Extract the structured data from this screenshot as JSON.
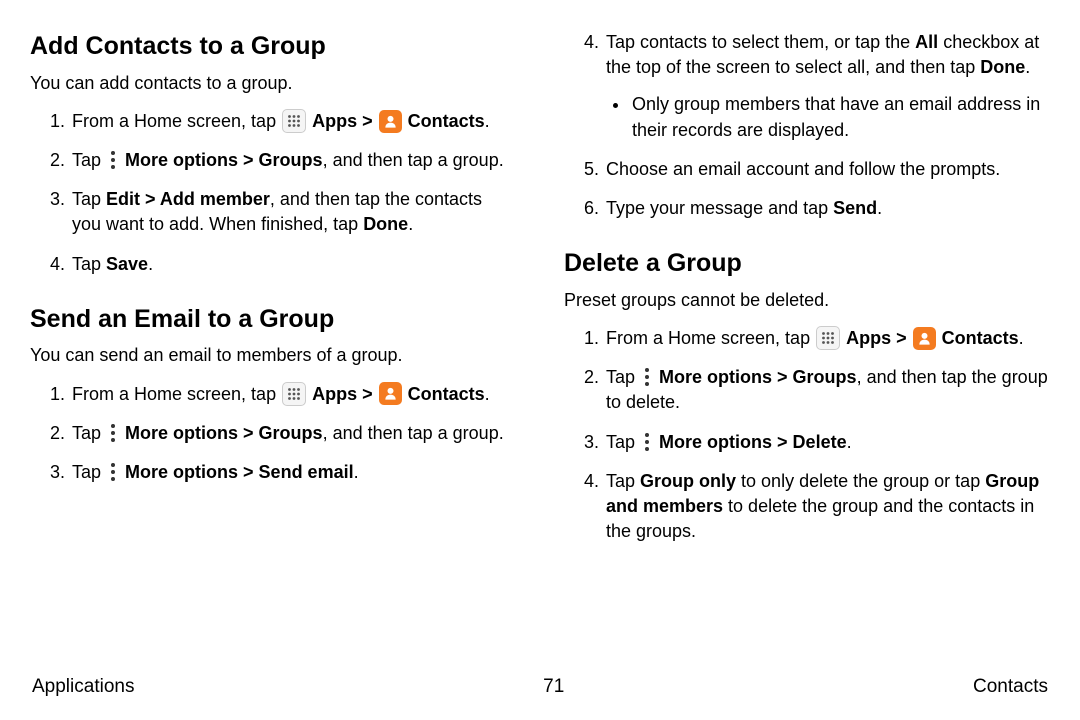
{
  "left": {
    "section1": {
      "heading": "Add Contacts to a Group",
      "intro": "You can add contacts to a group.",
      "step1_a": "From a Home screen, tap ",
      "apps_label": " Apps",
      "arrow": " > ",
      "contacts_label": " Contacts",
      "step1_end": ".",
      "step2_a": "Tap ",
      "step2_b": " More options > Groups",
      "step2_c": ", and then tap a group.",
      "step3_a": "Tap ",
      "step3_b": "Edit > Add member",
      "step3_c": ", and then tap the contacts you want to add. When finished, tap ",
      "step3_d": "Done",
      "step3_e": ".",
      "step4_a": "Tap ",
      "step4_b": "Save",
      "step4_c": "."
    },
    "section2": {
      "heading": "Send an Email to a Group",
      "intro": "You can send an email to members of a group.",
      "step1_a": "From a Home screen, tap ",
      "apps_label": " Apps",
      "arrow": " > ",
      "contacts_label": " Contacts",
      "step1_end": ".",
      "step2_a": "Tap ",
      "step2_b": " More options > Groups",
      "step2_c": ", and then tap a group.",
      "step3_a": "Tap ",
      "step3_b": " More options > Send email",
      "step3_c": "."
    }
  },
  "right": {
    "cont": {
      "step4_a": "Tap contacts to select them, or tap the ",
      "step4_b": "All",
      "step4_c": " checkbox at the top of the screen to select all, and then tap ",
      "step4_d": "Done",
      "step4_e": ".",
      "bullet1": "Only group members that have an email address in their records are displayed.",
      "step5": "Choose an email account and follow the prompts.",
      "step6_a": "Type your message and tap ",
      "step6_b": "Send",
      "step6_c": "."
    },
    "section3": {
      "heading": "Delete a Group",
      "intro": "Preset groups cannot be deleted.",
      "step1_a": "From a Home screen, tap ",
      "apps_label": " Apps",
      "arrow": " > ",
      "contacts_label": " Contacts",
      "step1_end": ".",
      "step2_a": "Tap ",
      "step2_b": " More options > Groups",
      "step2_c": ", and then tap the group to delete.",
      "step3_a": "Tap ",
      "step3_b": " More options > Delete",
      "step3_c": ".",
      "step4_a": "Tap ",
      "step4_b": "Group only",
      "step4_c": " to only delete the group or tap ",
      "step4_d": "Group and members",
      "step4_e": " to delete the group and the contacts in the groups."
    }
  },
  "footer": {
    "left": "Applications",
    "center": "71",
    "right": "Contacts"
  }
}
